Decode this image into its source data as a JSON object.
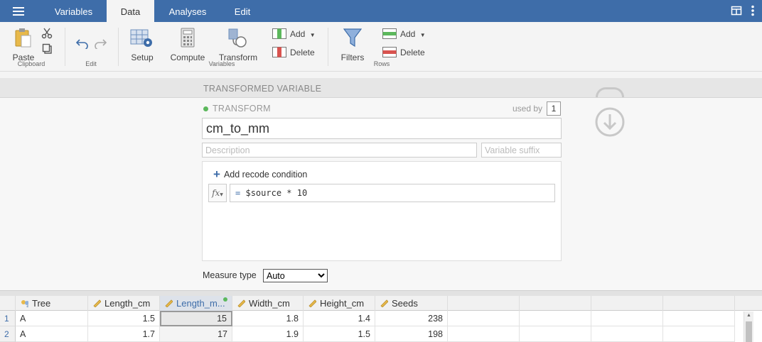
{
  "topbar": {
    "tabs": [
      {
        "label": "Variables",
        "active": false
      },
      {
        "label": "Data",
        "active": true
      },
      {
        "label": "Analyses",
        "active": false
      },
      {
        "label": "Edit",
        "active": false
      }
    ],
    "icons": [
      "hamburger-menu-icon",
      "split-view-icon",
      "more-options-icon"
    ]
  },
  "ribbon": {
    "clipboard": {
      "paste": "Paste",
      "group": "Clipboard"
    },
    "edit": {
      "group": "Edit"
    },
    "variables": {
      "setup": "Setup",
      "compute": "Compute",
      "transform": "Transform",
      "add": "Add",
      "delete": "Delete",
      "group": "Variables"
    },
    "rows": {
      "filters": "Filters",
      "add": "Add",
      "delete": "Delete",
      "group": "Rows"
    }
  },
  "panel": {
    "header": "TRANSFORMED VARIABLE",
    "type_label": "TRANSFORM",
    "used_by_label": "used by",
    "used_by_count": "1",
    "name": "cm_to_mm",
    "description_placeholder": "Description",
    "suffix_placeholder": "Variable suffix",
    "add_condition": "Add recode condition",
    "fx": "fx",
    "formula_eq": "=",
    "formula": "$source * 10",
    "measure_label": "Measure type",
    "measure_value": "Auto"
  },
  "sheet": {
    "columns": [
      {
        "name": "Tree",
        "type": "nominal-text"
      },
      {
        "name": "Length_cm",
        "type": "continuous"
      },
      {
        "name": "Length_m...",
        "type": "continuous",
        "selected": true
      },
      {
        "name": "Width_cm",
        "type": "continuous"
      },
      {
        "name": "Height_cm",
        "type": "continuous"
      },
      {
        "name": "Seeds",
        "type": "continuous"
      }
    ],
    "rows": [
      {
        "num": "1",
        "cells": [
          "A",
          "1.5",
          "15",
          "1.8",
          "1.4",
          "238"
        ]
      },
      {
        "num": "2",
        "cells": [
          "A",
          "1.7",
          "17",
          "1.9",
          "1.5",
          "198"
        ]
      }
    ]
  },
  "colors": {
    "accent": "#3e6da9",
    "status_dot": "#5cb85c"
  }
}
